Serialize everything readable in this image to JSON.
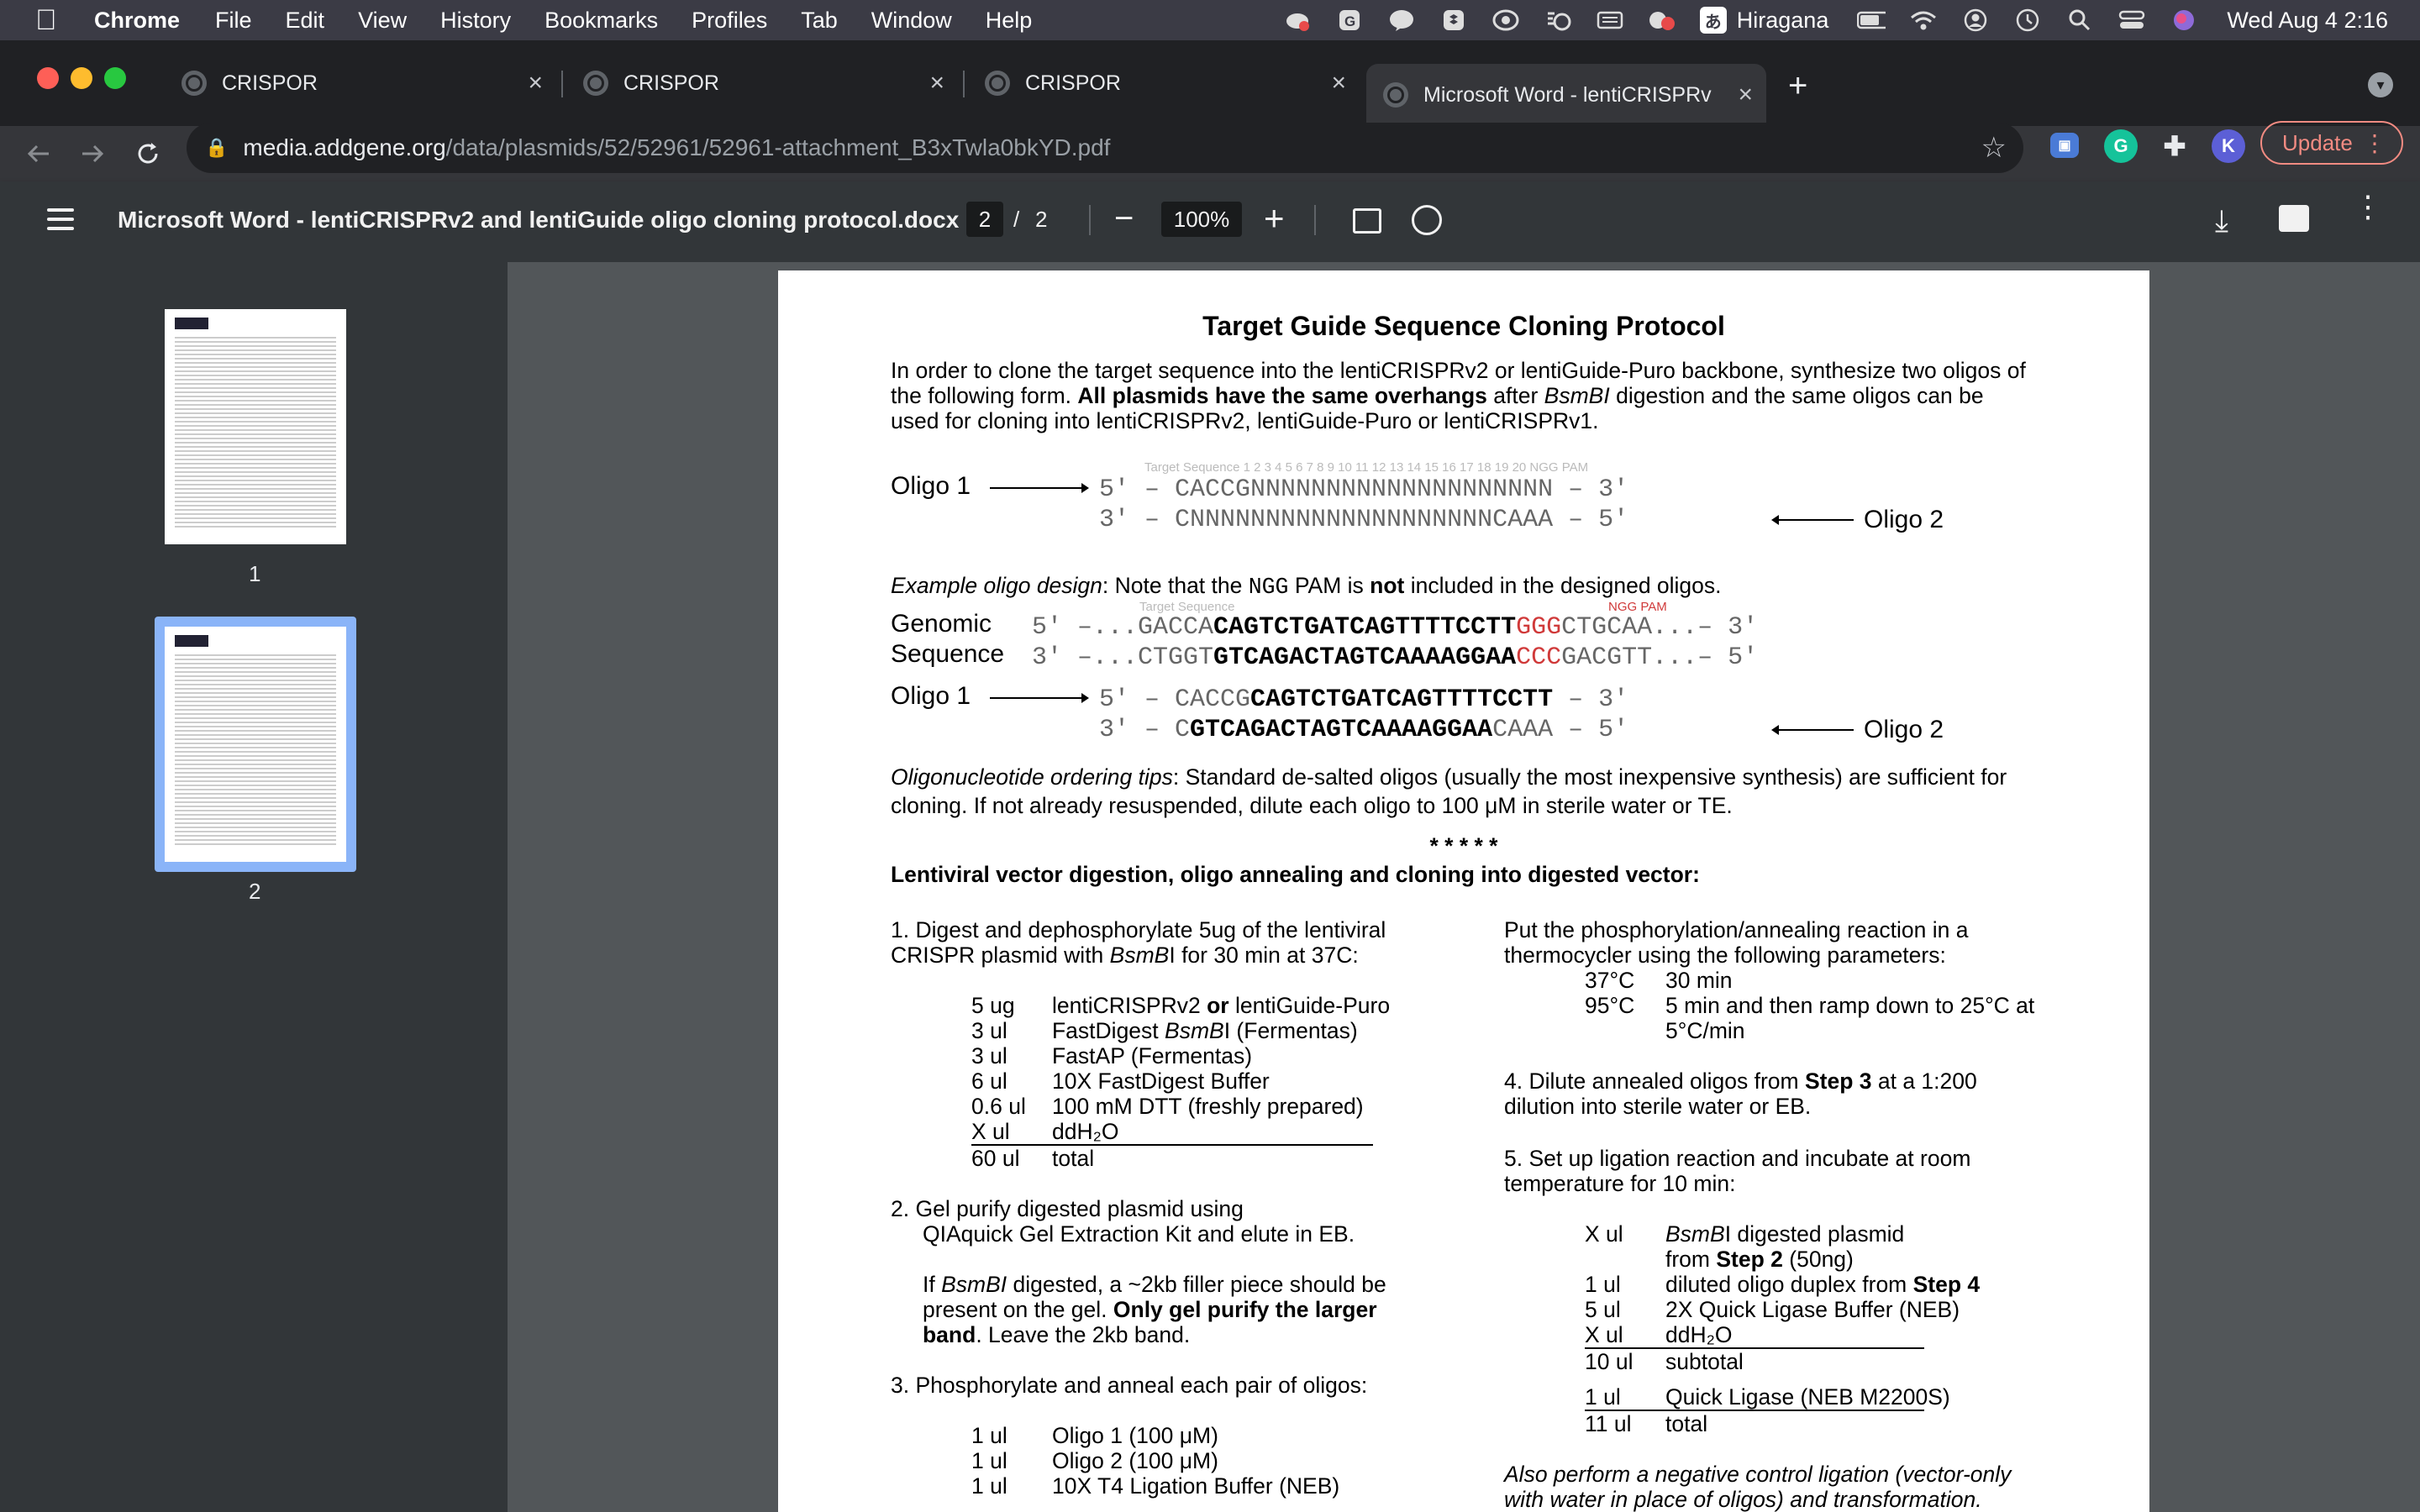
{
  "menubar": {
    "app": "Chrome",
    "items": [
      "File",
      "Edit",
      "View",
      "History",
      "Bookmarks",
      "Profiles",
      "Tab",
      "Window",
      "Help"
    ],
    "input_source": "Hiragana",
    "clock": "Wed Aug 4  2:16"
  },
  "tabs": [
    {
      "label": "CRISPOR"
    },
    {
      "label": "CRISPOR"
    },
    {
      "label": "CRISPOR"
    },
    {
      "label": "Microsoft Word - lentiCRISPRv"
    }
  ],
  "omnibox": {
    "host": "media.addgene.org",
    "path": "/data/plasmids/52/52961/52961-attachment_B3xTwla0bkYD.pdf"
  },
  "toolbar": {
    "profile_initial": "K",
    "update_label": "Update"
  },
  "pdf": {
    "doc_title": "Microsoft Word - lentiCRISPRv2 and lentiGuide oligo cloning protocol.docx",
    "current_page": "2",
    "page_separator": "/",
    "total_pages": "2",
    "zoom": "100%",
    "thumb_labels": [
      "1",
      "2"
    ]
  },
  "doc": {
    "title": "Target Guide Sequence Cloning Protocol",
    "intro_1": "In order to clone the target sequence into the lentiCRISPRv2 or lentiGuide-Puro backbone, synthesize two oligos of",
    "intro_2a": "the following form. ",
    "intro_2b": "All plasmids have the same overhangs",
    "intro_2c": " after ",
    "intro_2d": "BsmBI",
    "intro_2e": " digestion and the same oligos can be",
    "intro_3": "used for cloning into lentiCRISPRv2, lentiGuide-Puro or lentiCRISPRv1.",
    "target_seq_caption": "Target Sequence  1  2  3  4  5  6  7  8  9 10 11 12 13 14 15 16 17 18 19 20     NGG PAM",
    "oligo1_label": "Oligo 1",
    "oligo2_label": "Oligo 2",
    "generic_oligo1": "5′  –  CACCGNNNNNNNNNNNNNNNNNNNN          –  3′",
    "generic_oligo2": "3′  –        CNNNNNNNNNNNNNNNNNNNNCAAA  –  5′",
    "example_label": "Example oligo design",
    "example_text_a": ": Note that the ",
    "example_ngg": "NGG",
    "example_text_b": " PAM is ",
    "example_not": "not",
    "example_text_c": " included in the designed oligos.",
    "target_seq_caption_2": "Target Sequence",
    "ngg_pam_caption": "NGG PAM",
    "genomic_label": "Genomic",
    "sequence_label": "Sequence",
    "genomic_top_pre": "5′  –...GACCA",
    "genomic_top_bold": "CAGTCTGATCAGTTTTCCTT",
    "genomic_top_red": "GGG",
    "genomic_top_post": "CTGCAA...–  3′",
    "genomic_bot_pre": "3′  –...CTGGT",
    "genomic_bot_bold": "GTCAGACTAGTCAAAAGGAA",
    "genomic_bot_red": "CCC",
    "genomic_bot_post": "GACGTT...–  5′",
    "ex_oligo1_pre": "5′  –  CACCG",
    "ex_oligo1_bold": "CAGTCTGATCAGTTTTCCTT",
    "ex_oligo1_post": "        –  3′",
    "ex_oligo2_pre": "3′  –        C",
    "ex_oligo2_bold": "GTCAGACTAGTCAAAAGGAA",
    "ex_oligo2_post": "CAAA  –  5′",
    "tips_label": "Oligonucleotide ordering tips",
    "tips_1": ": Standard de-salted oligos (usually the most inexpensive synthesis) are sufficient for",
    "tips_2": "cloning. If not already resuspended, dilute each oligo to 100 μM in sterile water or TE.",
    "stars": "*     *     *     *     *",
    "section_heading": "Lentiviral vector digestion, oligo annealing and cloning into digested vector:",
    "step1_a": "1.  Digest and dephosphorylate 5ug of the lentiviral",
    "step1_b_pre": "CRISPR plasmid with ",
    "step1_b_it": "BsmB",
    "step1_b_post": "I for 30 min at 37C:",
    "digest": [
      {
        "amt": "5 ug",
        "desc_pre": "lentiCRISPRv2 ",
        "desc_bold": "or",
        "desc_post": " lentiGuide-Puro"
      },
      {
        "amt": "3 ul",
        "desc_pre": "FastDigest ",
        "desc_it": "BsmB",
        "desc_post": "I (Fermentas)"
      },
      {
        "amt": "3 ul",
        "desc_pre": "FastAP (Fermentas)"
      },
      {
        "amt": "6 ul",
        "desc_pre": "10X FastDigest Buffer"
      },
      {
        "amt": "0.6 ul",
        "desc_pre": "100 mM DTT (freshly prepared)"
      },
      {
        "amt": "X ul",
        "desc_pre": "ddH₂O"
      },
      {
        "amt": "60 ul",
        "desc_pre": "total"
      }
    ],
    "step2_a": "2.  Gel purify digested plasmid using",
    "step2_b": "QIAquick Gel Extraction Kit and elute in EB.",
    "step2_c_pre": "If ",
    "step2_c_it": "BsmBI",
    "step2_c_post": " digested, a ~2kb filler piece should be",
    "step2_d_pre": "present on the gel. ",
    "step2_d_bold": "Only gel purify the larger",
    "step2_e_bold": "band",
    "step2_e_post": ". Leave the 2kb band.",
    "step3": "3. Phosphorylate and anneal each pair of oligos:",
    "anneal": [
      {
        "amt": "1 ul",
        "desc": "Oligo 1 (100 μM)"
      },
      {
        "amt": "1 ul",
        "desc": "Oligo 2 (100 μM)"
      },
      {
        "amt": "1 ul",
        "desc": "10X T4 Ligation Buffer (NEB)"
      }
    ],
    "thermo_a": "Put the phosphorylation/annealing reaction in a",
    "thermo_b": "thermocycler using the following parameters:",
    "thermo_rows": [
      {
        "temp": "37°C",
        "desc": "30 min"
      },
      {
        "temp": "95°C",
        "desc": "5 min and then ramp down to 25°C at"
      },
      {
        "temp": "",
        "desc": "5°C/min"
      }
    ],
    "step4_a_pre": "4.  Dilute annealed oligos from ",
    "step4_a_bold": "Step 3",
    "step4_a_post": " at a 1:200",
    "step4_b": "dilution into sterile water or EB.",
    "step5_a": "5. Set up ligation reaction and incubate at room",
    "step5_b": "temperature for 10 min:",
    "ligation": [
      {
        "amt": "X ul",
        "desc_it": "BsmB",
        "desc_post": "I digested plasmid"
      },
      {
        "amt": "",
        "desc_pre": "from ",
        "desc_bold": "Step 2",
        "desc_post": " (50ng)"
      },
      {
        "amt": "1 ul",
        "desc_pre": "diluted oligo duplex from ",
        "desc_bold": "Step 4"
      },
      {
        "amt": "5 ul",
        "desc_pre": "2X Quick Ligase Buffer (NEB)"
      },
      {
        "amt": "X ul",
        "desc_pre": "ddH₂O"
      },
      {
        "amt": "10 ul",
        "desc_pre": "subtotal"
      },
      {
        "amt": "1 ul",
        "desc_pre": "Quick Ligase (NEB M2200S)"
      },
      {
        "amt": "11 ul",
        "desc_pre": "total"
      }
    ],
    "neg_control_a": "Also perform a negative control ligation (vector-only",
    "neg_control_b": "with water in place of oligos) and transformation."
  }
}
